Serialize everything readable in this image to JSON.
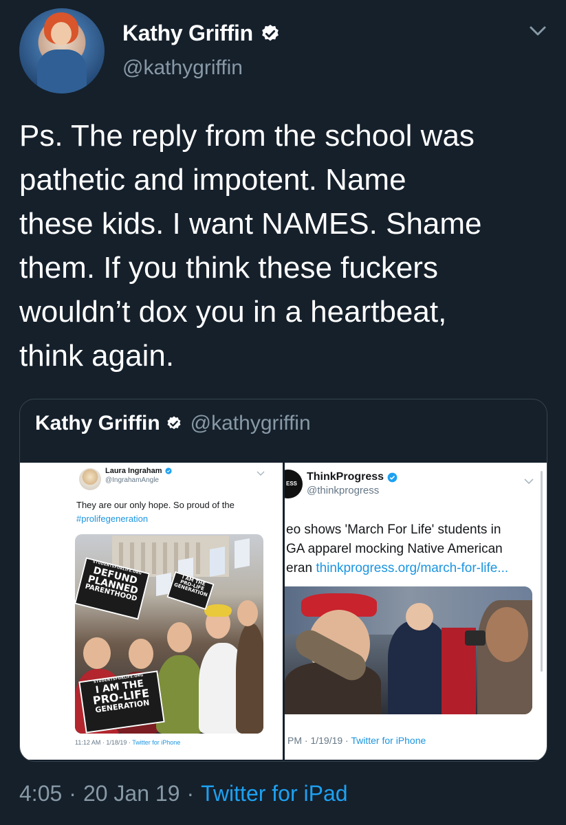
{
  "author": {
    "name": "Kathy Griffin",
    "handle": "@kathygriffin"
  },
  "tweet": {
    "text": "Ps. The reply from the school was\npathetic and impotent. Name\nthese kids. I want NAMES. Shame\nthem. If you think these fuckers\nwouldn’t dox you in a heartbeat,\nthink again.",
    "time": "4:05",
    "date": "20 Jan 19",
    "source": "Twitter for iPad",
    "separator": "·"
  },
  "quoted": {
    "name": "Kathy Griffin",
    "handle": "@kathygriffin",
    "left_screenshot": {
      "name": "Laura Ingraham",
      "handle": "@IngrahamAngle",
      "text": "They are our only hope. So proud of the",
      "hashtag": "#prolifegeneration",
      "footer_time": "11:12 AM · 1/18/19 ·",
      "footer_source": "Twitter for iPhone",
      "sign1_small": "STUDENTSFORLIFE.ORG",
      "sign1_line1": "DEFUND",
      "sign1_line2": "PLANNED",
      "sign1_line3": "PARENTHOOD",
      "sign2_small": "STUDENTSFORLIFE.ORG",
      "sign2_line1": "I AM THE",
      "sign2_line2": "PRO-LIFE",
      "sign2_line3": "GENERATION",
      "sign3_line1": "I AM THE",
      "sign3_line2": "PRO-LIFE",
      "sign3_line3": "GENERATION"
    },
    "right_screenshot": {
      "avatar_text": "ESS",
      "name": "ThinkProgress",
      "handle": "@thinkprogress",
      "line1": "eo shows 'March For Life' students in",
      "line2": "GA apparel mocking Native American",
      "line3_text": "eran ",
      "line3_link": "thinkprogress.org/march-for-life...",
      "footer_time": "PM · 1/19/19 ·",
      "footer_source": "Twitter for iPhone"
    }
  },
  "colors": {
    "background": "#15202b",
    "secondary_text": "#8899a6",
    "accent": "#1da1f2",
    "border": "#38444d"
  }
}
